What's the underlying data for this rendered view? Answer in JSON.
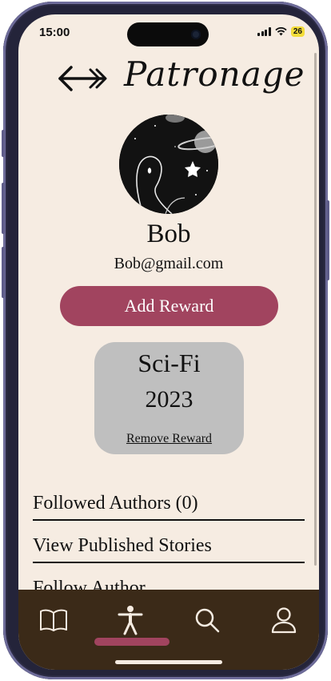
{
  "status_bar": {
    "time": "15:00",
    "battery": "26"
  },
  "header": {
    "title": "Patronage"
  },
  "profile": {
    "name": "Bob",
    "email": "Bob@gmail.com"
  },
  "actions": {
    "add_reward_label": "Add Reward"
  },
  "reward": {
    "genre": "Sci-Fi",
    "year": "2023",
    "remove_label": "Remove Reward"
  },
  "menu": {
    "items": [
      {
        "label": "Followed Authors (0)"
      },
      {
        "label": "View Published Stories"
      },
      {
        "label": "Follow Author"
      }
    ]
  },
  "bottom_nav": {
    "items": [
      {
        "icon": "book-icon"
      },
      {
        "icon": "accessibility-icon",
        "active": true
      },
      {
        "icon": "search-icon"
      },
      {
        "icon": "user-icon"
      }
    ]
  },
  "colors": {
    "background": "#f6ece2",
    "accent": "#a1445f",
    "nav_bar": "#3b2a18",
    "card": "#bfbfbf"
  }
}
